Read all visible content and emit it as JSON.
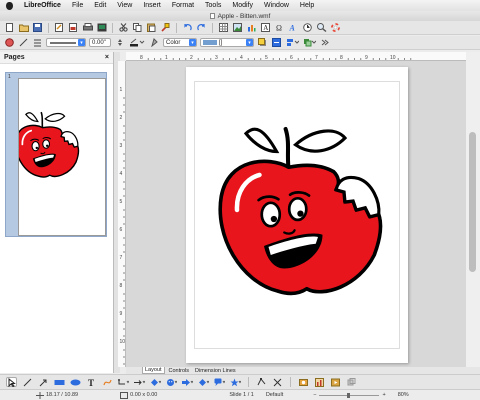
{
  "menubar": {
    "app_name": "LibreOffice",
    "items": [
      "File",
      "Edit",
      "View",
      "Insert",
      "Format",
      "Tools",
      "Modify",
      "Window",
      "Help"
    ]
  },
  "window": {
    "title": "Apple - Bitten.wmf"
  },
  "toolbar2": {
    "line_width": "0.00\"",
    "area_style": "Color",
    "area_color": "[]"
  },
  "sidebar": {
    "title": "Pages",
    "close": "×",
    "thumb_number": "1"
  },
  "ruler": {
    "h_labels": [
      "8",
      "1",
      "2",
      "3",
      "4",
      "5",
      "6",
      "7",
      "8",
      "9",
      "10"
    ],
    "v_labels": [
      "1",
      "2",
      "3",
      "4",
      "5",
      "6",
      "7",
      "8",
      "9",
      "10"
    ]
  },
  "tabs": [
    "Layout",
    "Controls",
    "Dimension Lines"
  ],
  "status": {
    "position": "18.17 / 10.89",
    "size": "0.00 x 0.00",
    "slide": "Slide 1 / 1",
    "layout": "Default",
    "zoom": "80%"
  },
  "colors": {
    "apple_red": "#e8151d",
    "accent": "#3b82f6"
  }
}
